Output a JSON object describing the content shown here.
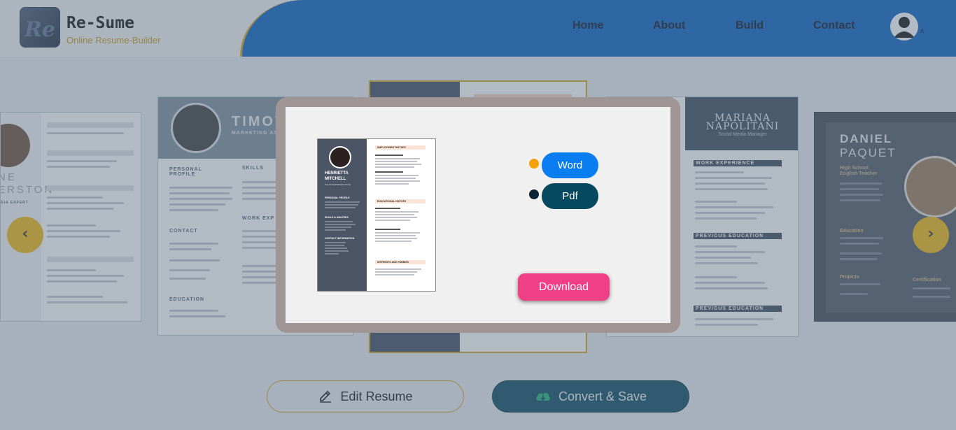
{
  "header": {
    "logo_mark": "Re",
    "brand_name": "Re-Sume",
    "brand_tagline": "Online Resume-Builder",
    "nav": [
      "Home",
      "About",
      "Build",
      "Contact"
    ],
    "user_caret": "˄"
  },
  "carousel": {
    "prev_label": "‹",
    "next_label": "›",
    "card_left": {
      "name_line1": "NE",
      "name_line2": "ERSTON",
      "subtitle": "DIA EXPERT"
    },
    "card_timothy": {
      "name": "TIMOTH",
      "subtitle": "MARKETING ASS",
      "sections": [
        "PERSONAL PROFILE",
        "CONTACT",
        "EDUCATION",
        "SKILLS",
        "WORK EXP"
      ]
    },
    "card_mariana": {
      "name_line1": "MARIANA",
      "name_line2": "NAPOLITANI",
      "subtitle": "Social Media Manager",
      "sections": [
        "WORK EXPERIENCE",
        "PREVIOUS EDUCATION",
        "PREVIOUS EDUCATION"
      ]
    },
    "card_daniel": {
      "name_line1": "DANIEL",
      "name_line2": "PAQUET",
      "subtitle_line1": "High School",
      "subtitle_line2": "English Teacher",
      "sections": [
        "Education",
        "Projects",
        "Certification"
      ]
    }
  },
  "modal": {
    "preview": {
      "name_line1": "HENRIETTA",
      "name_line2": "MITCHELL",
      "role": "SALES REPRESENTATIVE",
      "left_sections": [
        "PERSONAL PROFILE",
        "SKILLS & ABILITIES",
        "CONTACT INFORMATION"
      ],
      "right_sections": [
        "EMPLOYMENT HISTORY",
        "EDUCATIONAL HISTORY",
        "INTERESTS AND HOBBIES"
      ]
    },
    "formats": [
      {
        "label": "Word",
        "color": "#0a7ef0",
        "dot_color": "#f3a10b"
      },
      {
        "label": "Pdf",
        "color": "#06485e",
        "dot_color": "#0c2235"
      }
    ],
    "download_label": "Download"
  },
  "actions": {
    "edit_label": "Edit Resume",
    "convert_label": "Convert & Save"
  },
  "colors": {
    "primary": "#0260c4",
    "accent": "#d6a520",
    "download": "#ef3f86"
  }
}
